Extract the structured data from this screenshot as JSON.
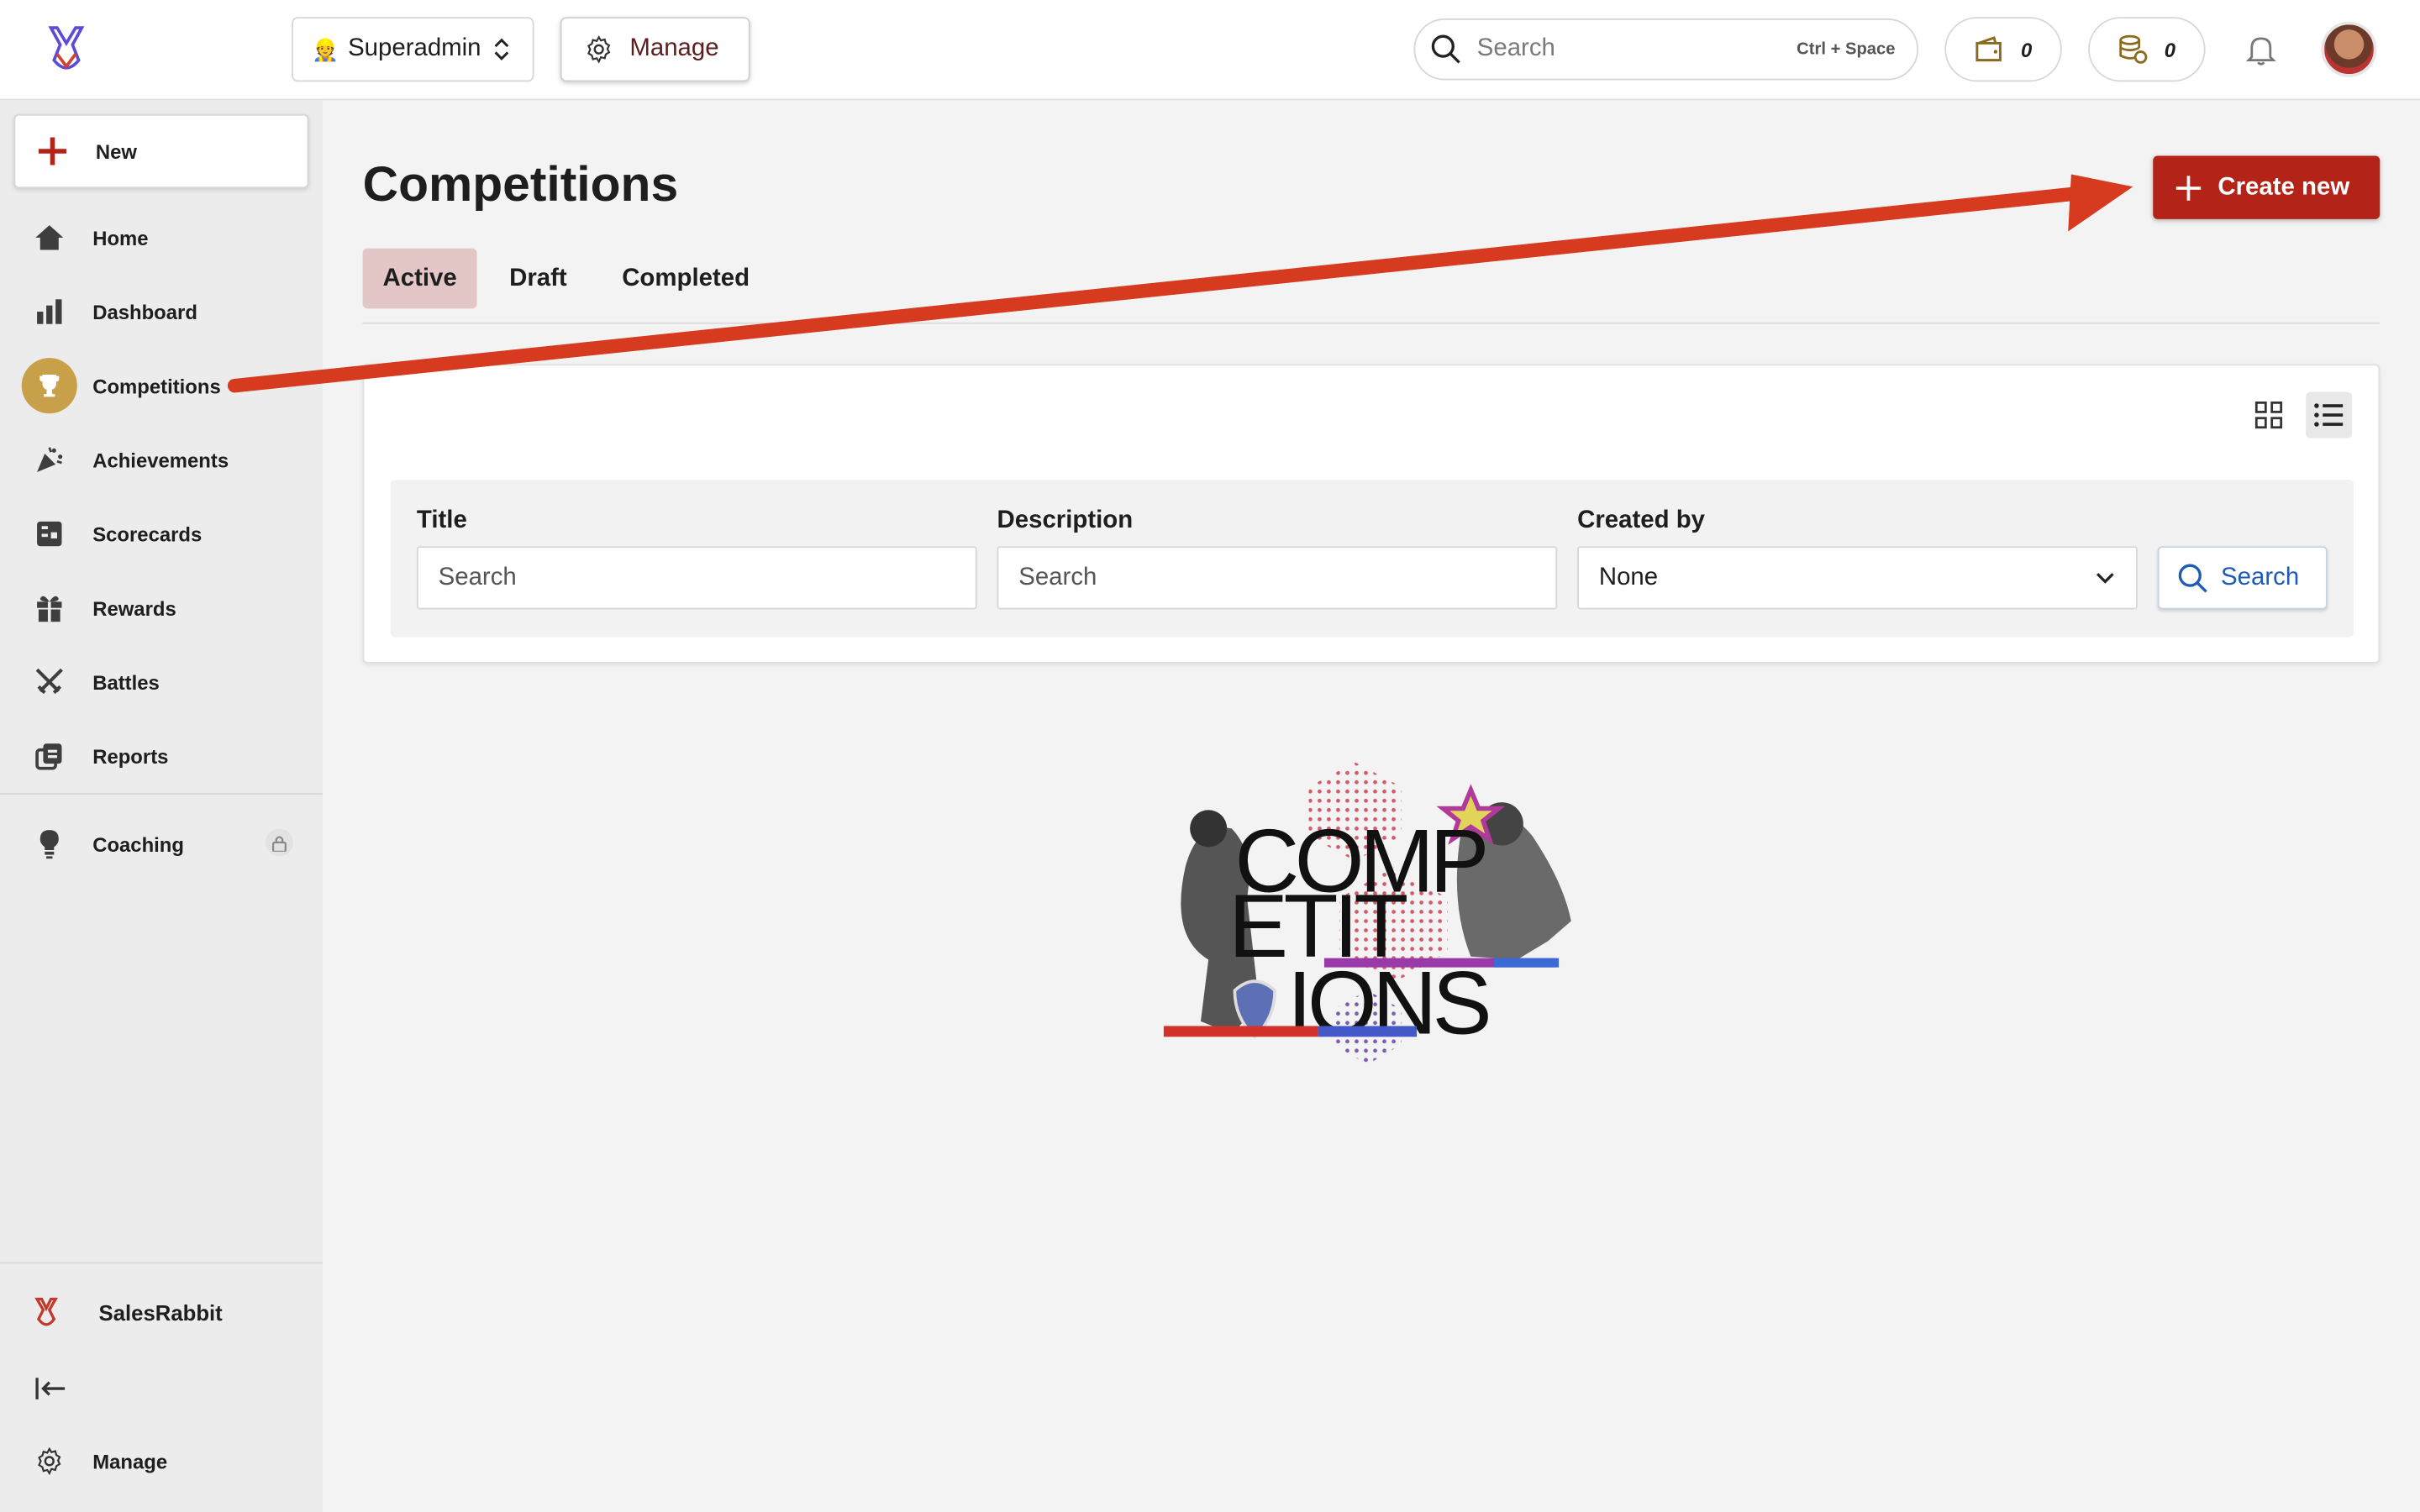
{
  "topbar": {
    "role_label": "Superadmin",
    "role_emoji": "👷",
    "manage_label": "Manage",
    "search_placeholder": "Search",
    "search_shortcut": "Ctrl + Space",
    "wallet_count": "0",
    "coins_count": "0"
  },
  "sidebar": {
    "new_label": "New",
    "items": [
      {
        "label": "Home",
        "icon": "home-icon"
      },
      {
        "label": "Dashboard",
        "icon": "bar-chart-icon"
      },
      {
        "label": "Competitions",
        "icon": "trophy-icon"
      },
      {
        "label": "Achievements",
        "icon": "party-popper-icon"
      },
      {
        "label": "Scorecards",
        "icon": "scorecard-icon"
      },
      {
        "label": "Rewards",
        "icon": "gift-icon"
      },
      {
        "label": "Battles",
        "icon": "crossed-swords-icon"
      },
      {
        "label": "Reports",
        "icon": "reports-icon"
      },
      {
        "label": "Coaching",
        "icon": "lightbulb-icon"
      }
    ],
    "brand_label": "SalesRabbit",
    "bottom_manage_label": "Manage"
  },
  "main": {
    "title": "Competitions",
    "create_label": "Create new",
    "tabs": [
      {
        "label": "Active",
        "active": true
      },
      {
        "label": "Draft",
        "active": false
      },
      {
        "label": "Completed",
        "active": false
      }
    ],
    "filters": {
      "title_label": "Title",
      "title_placeholder": "Search",
      "description_label": "Description",
      "description_placeholder": "Search",
      "created_by_label": "Created by",
      "created_by_value": "None",
      "search_button": "Search"
    },
    "hero_text": [
      "COMP",
      "ETIT",
      "IONS"
    ]
  },
  "colors": {
    "accent": "#b42318",
    "active_tab_bg": "#e3c7c7",
    "active_nav_bg": "#c9a04a",
    "link_blue": "#1e5bb7"
  }
}
